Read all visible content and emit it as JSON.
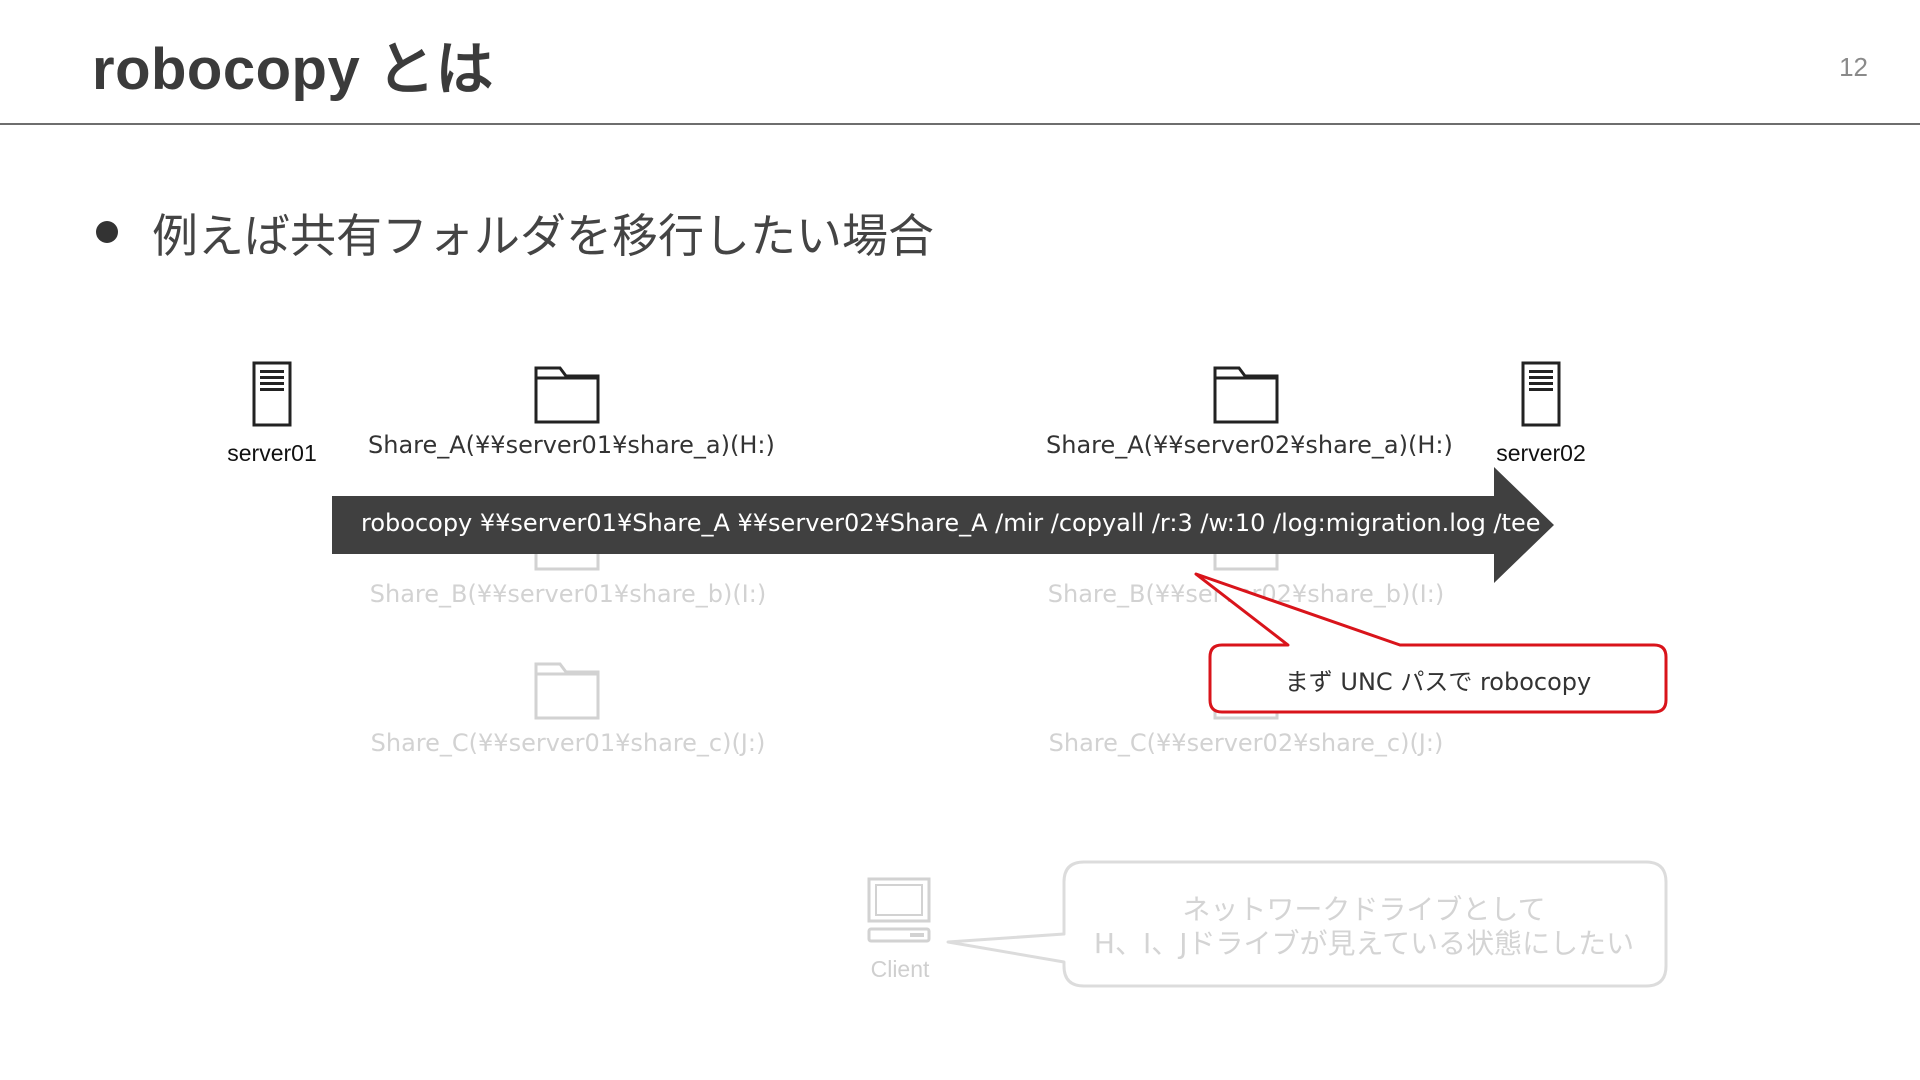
{
  "slide": {
    "title": "robocopy とは",
    "page_number": "12",
    "bullet": "例えば共有フォルダを移行したい場合"
  },
  "diagram": {
    "server_left": {
      "label": "server01",
      "icon": "server-icon"
    },
    "server_right": {
      "label": "server02",
      "icon": "server-icon"
    },
    "shares_left": [
      {
        "label": "Share_A(¥¥server01¥share_a)(H:)",
        "icon": "folder-icon"
      },
      {
        "label": "Share_B(¥¥server01¥share_b)(I:)",
        "icon": "folder-icon"
      },
      {
        "label": "Share_C(¥¥server01¥share_c)(J:)",
        "icon": "folder-icon"
      }
    ],
    "shares_right": [
      {
        "label": "Share_A(¥¥server02¥share_a)(H:)",
        "icon": "folder-icon"
      },
      {
        "label": "Share_B(¥¥server02¥share_b)(I:)",
        "icon": "folder-icon"
      },
      {
        "label": "Share_C(¥¥server02¥share_c)(J:)",
        "icon": "folder-icon"
      }
    ],
    "command": "robocopy ¥¥server01¥Share_A ¥¥server02¥Share_A /mir /copyall /r:3 /w:10 /log:migration.log /tee",
    "callout": "まず UNC パスで robocopy",
    "client": {
      "label": "Client",
      "icon": "computer-icon"
    },
    "speech": {
      "line1": "ネットワークドライブとして",
      "line2": "H、I、Jドライブが見えている状態にしたい"
    }
  },
  "colors": {
    "arrow": "#404040",
    "callout_border": "#d9141b",
    "faded": "#d2d2d2",
    "title_text": "#3b3b3b"
  }
}
